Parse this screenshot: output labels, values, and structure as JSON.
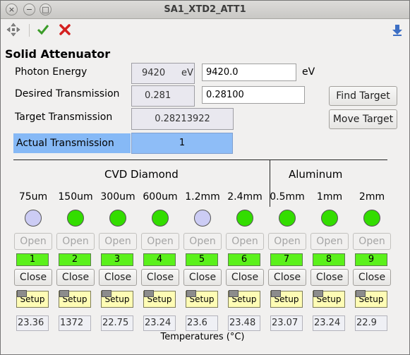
{
  "window": {
    "title": "SA1_XTD2_ATT1",
    "close_glyph": "×",
    "minimize_glyph": "−",
    "maximize_glyph": "□"
  },
  "toolbar": {
    "icons": [
      "move-icon",
      "checkmark-icon",
      "close-x-icon",
      "download-arrow-icon"
    ]
  },
  "heading": "Solid Attenuator",
  "photon_energy": {
    "label": "Photon Energy",
    "readback": "9420",
    "readback_unit": "eV",
    "setpoint": "9420.0",
    "setpoint_unit": "eV"
  },
  "desired_transmission": {
    "label": "Desired Transmission",
    "readback": "0.281",
    "setpoint": "0.28100"
  },
  "target_transmission": {
    "label": "Target Transmission",
    "value": "0.28213922"
  },
  "actual_transmission": {
    "label": "Actual Transmission",
    "value": "1"
  },
  "buttons": {
    "find_target": "Find Target",
    "move_target": "Move Target"
  },
  "groups": {
    "diamond": "CVD Diamond",
    "aluminum": "Aluminum"
  },
  "filters": [
    {
      "thickness": "75um",
      "state": "off",
      "number": "1",
      "temp": "23.36"
    },
    {
      "thickness": "150um",
      "state": "on",
      "number": "2",
      "temp": "1372"
    },
    {
      "thickness": "300um",
      "state": "on",
      "number": "3",
      "temp": "22.75"
    },
    {
      "thickness": "600um",
      "state": "on",
      "number": "4",
      "temp": "23.24"
    },
    {
      "thickness": "1.2mm",
      "state": "off",
      "number": "5",
      "temp": "23.6"
    },
    {
      "thickness": "2.4mm",
      "state": "on",
      "number": "6",
      "temp": "23.48"
    },
    {
      "thickness": "0.5mm",
      "state": "on",
      "number": "7",
      "temp": "23.07"
    },
    {
      "thickness": "1mm",
      "state": "on",
      "number": "8",
      "temp": "23.24"
    },
    {
      "thickness": "2mm",
      "state": "on",
      "number": "9",
      "temp": "22.9"
    }
  ],
  "filter_labels": {
    "open": "Open",
    "close": "Close",
    "setup": "Setup"
  },
  "colors": {
    "led_on": "#33dd00",
    "led_off": "#ccccf4",
    "highlight": "#86b9f6",
    "number_bg": "#5bf11b"
  },
  "temperatures_label": "Temperatures (°C)"
}
